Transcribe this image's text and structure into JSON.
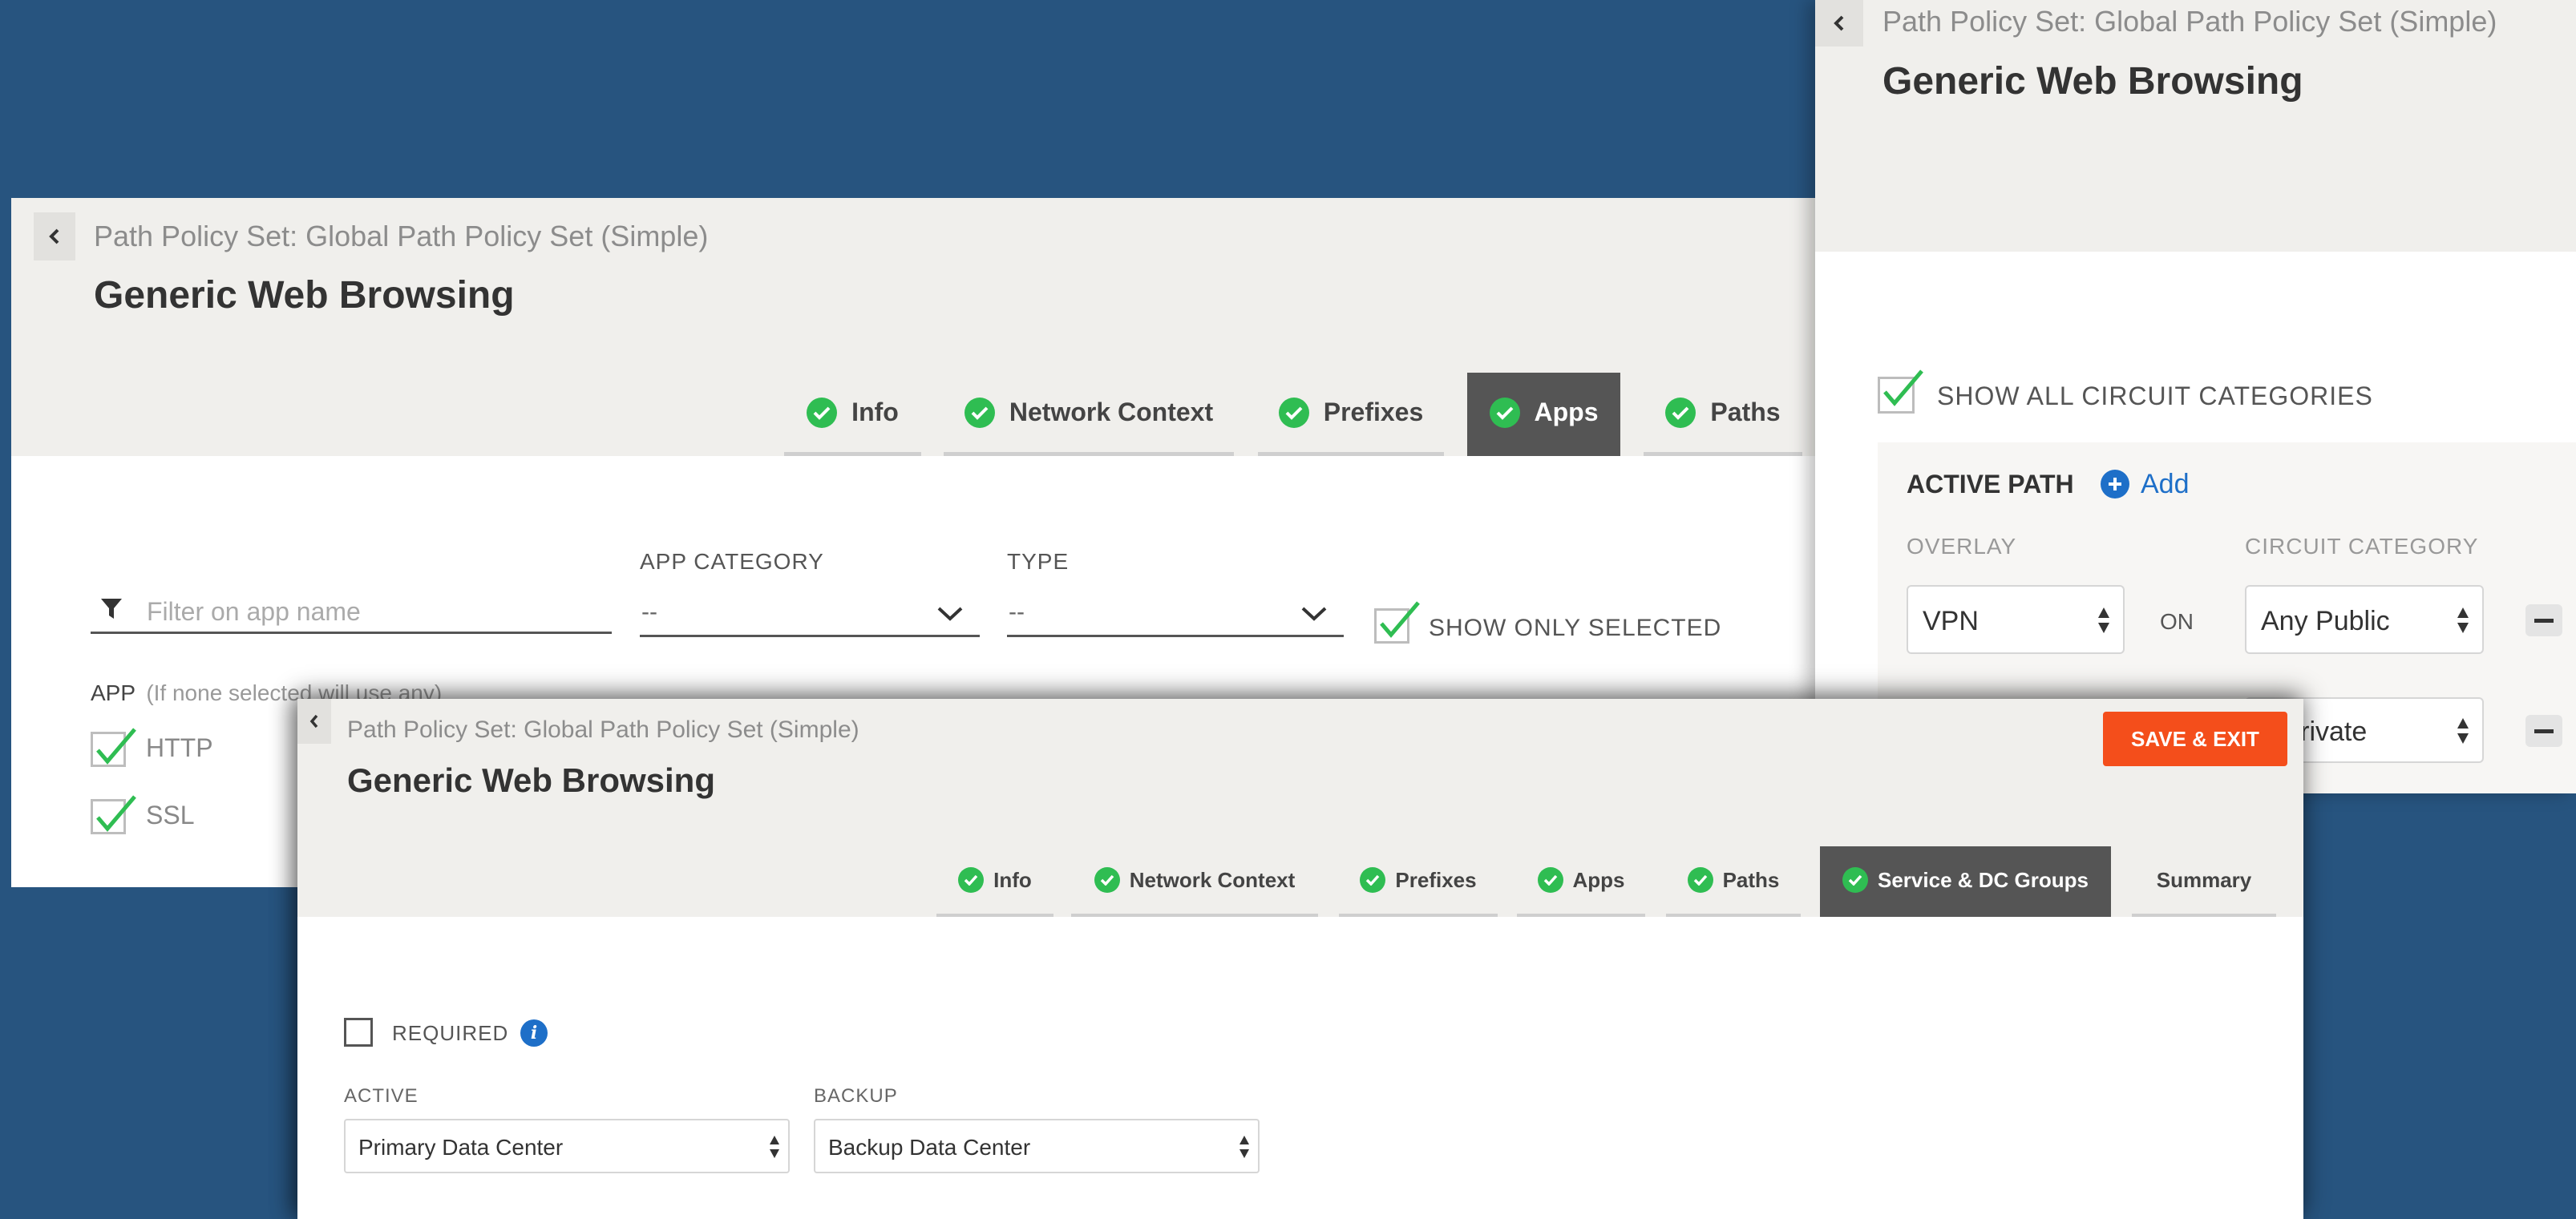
{
  "colors": {
    "background": "#27547f",
    "header_bg": "#f0efec",
    "accent_green": "#2fbd52",
    "active_tab": "#555555",
    "save_button": "#f44e1b",
    "link_blue": "#1e6fc8"
  },
  "panel_apps": {
    "subtitle": "Path Policy Set: Global Path Policy Set (Simple)",
    "title": "Generic Web Browsing",
    "tabs": [
      {
        "label": "Info",
        "icon": "check-circle-icon"
      },
      {
        "label": "Network Context",
        "icon": "check-circle-icon"
      },
      {
        "label": "Prefixes",
        "icon": "check-circle-icon"
      },
      {
        "label": "Apps",
        "icon": "check-circle-icon",
        "active": true
      },
      {
        "label": "Paths",
        "icon": "check-circle-icon"
      }
    ],
    "filter_placeholder": "Filter on app name",
    "app_category_label": "APP CATEGORY",
    "app_category_value": "--",
    "type_label": "TYPE",
    "type_value": "--",
    "show_only_selected": "SHOW ONLY SELECTED",
    "app_label": "APP",
    "app_hint": "(If none selected will use any)",
    "apps": [
      "HTTP",
      "SSL"
    ]
  },
  "panel_paths": {
    "subtitle": "Path Policy Set: Global Path Policy Set (Simple)",
    "title": "Generic Web Browsing",
    "show_all_circuit_categories": "SHOW ALL CIRCUIT CATEGORIES",
    "active_path_label": "ACTIVE PATH",
    "add_label": "Add",
    "overlay_label": "OVERLAY",
    "circuit_category_label": "CIRCUIT CATEGORY",
    "row1": {
      "overlay": "VPN",
      "on": "ON",
      "circuit": "Any Public"
    },
    "row2": {
      "circuit": "y Private"
    }
  },
  "panel_service": {
    "subtitle": "Path Policy Set: Global Path Policy Set (Simple)",
    "title": "Generic Web Browsing",
    "save_exit": "SAVE & EXIT",
    "tabs": [
      {
        "label": "Info",
        "icon": "check-circle-icon"
      },
      {
        "label": "Network Context",
        "icon": "check-circle-icon"
      },
      {
        "label": "Prefixes",
        "icon": "check-circle-icon"
      },
      {
        "label": "Apps",
        "icon": "check-circle-icon"
      },
      {
        "label": "Paths",
        "icon": "check-circle-icon"
      },
      {
        "label": "Service & DC Groups",
        "icon": "check-circle-icon",
        "active": true
      },
      {
        "label": "Summary"
      }
    ],
    "required_label": "REQUIRED",
    "active_label": "ACTIVE",
    "active_value": "Primary Data Center",
    "backup_label": "BACKUP",
    "backup_value": "Backup Data Center"
  }
}
